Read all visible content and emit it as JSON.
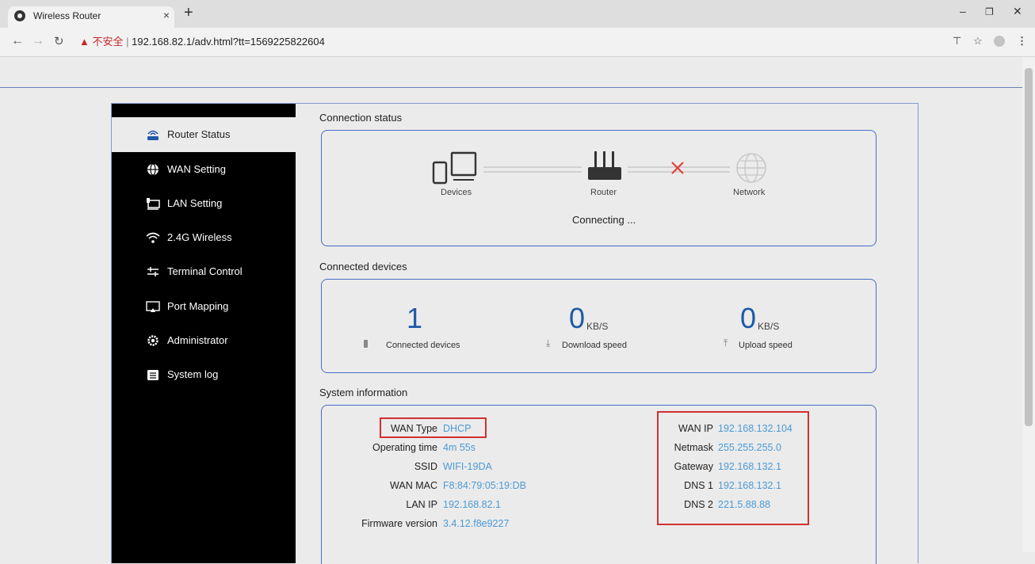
{
  "browser": {
    "tab_title": "Wireless Router",
    "tab_close": "×",
    "new_tab": "+",
    "security_warning": "▲ 不安全",
    "url": "192.168.82.1/adv.html?tt=1569225822604"
  },
  "sidebar": {
    "items": [
      {
        "label": "Router Status",
        "icon": "router-icon",
        "active": true
      },
      {
        "label": "WAN Setting",
        "icon": "globe-icon"
      },
      {
        "label": "LAN Setting",
        "icon": "lan-icon"
      },
      {
        "label": "2.4G Wireless",
        "icon": "wifi-icon"
      },
      {
        "label": "Terminal Control",
        "icon": "sliders-icon"
      },
      {
        "label": "Port Mapping",
        "icon": "port-mapping-icon"
      },
      {
        "label": "Administrator",
        "icon": "gear-icon"
      },
      {
        "label": "System log",
        "icon": "log-icon"
      }
    ]
  },
  "connection_status": {
    "title": "Connection status",
    "devices_label": "Devices",
    "router_label": "Router",
    "network_label": "Network",
    "status_text": "Connecting ...",
    "link_status_color": "#e53935"
  },
  "connected_devices": {
    "title": "Connected devices",
    "count": "1",
    "count_label": "Connected devices",
    "download_value": "0",
    "download_unit": "KB/S",
    "download_label": "Download speed",
    "upload_value": "0",
    "upload_unit": "KB/S",
    "upload_label": "Upload speed"
  },
  "system_info": {
    "title": "System information",
    "left": [
      {
        "key": "WAN Type",
        "value": "DHCP"
      },
      {
        "key": "Operating time",
        "value": "4m 55s"
      },
      {
        "key": "SSID",
        "value": "WIFI-19DA"
      },
      {
        "key": "WAN MAC",
        "value": "F8:84:79:05:19:DB"
      },
      {
        "key": "LAN IP",
        "value": "192.168.82.1"
      },
      {
        "key": "Firmware version",
        "value": "3.4.12.f8e9227"
      }
    ],
    "right": [
      {
        "key": "WAN IP",
        "value": "192.168.132.104"
      },
      {
        "key": "Netmask",
        "value": "255.255.255.0"
      },
      {
        "key": "Gateway",
        "value": "192.168.132.1"
      },
      {
        "key": "DNS 1",
        "value": "192.168.132.1"
      },
      {
        "key": "DNS 2",
        "value": "221.5.88.88"
      }
    ]
  },
  "colors": {
    "accent": "#1f5aa8",
    "value_link": "#4c9ad6",
    "highlight_box": "#d32f2f"
  }
}
